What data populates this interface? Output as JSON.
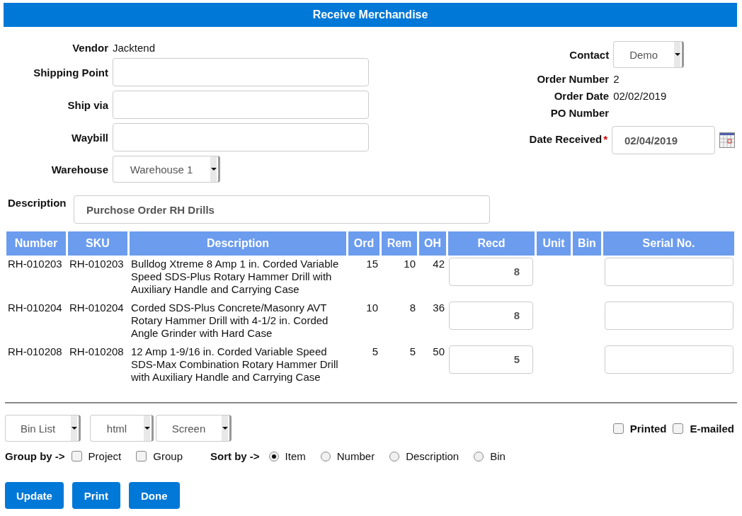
{
  "window": {
    "title": "Receive Merchandise"
  },
  "left_fields": [
    {
      "kind": "text",
      "label": "Vendor",
      "value": "Jacktend"
    },
    {
      "kind": "input",
      "label": "Shipping Point"
    },
    {
      "kind": "input",
      "label": "Ship via"
    },
    {
      "kind": "input",
      "label": "Waybill"
    },
    {
      "kind": "select",
      "label": "Warehouse",
      "value": "Warehouse 1"
    }
  ],
  "right_fields": [
    {
      "kind": "select",
      "label": "Contact",
      "value": "Demo"
    },
    {
      "kind": "text",
      "label": "Order Number",
      "value": "2"
    },
    {
      "kind": "text",
      "label": "Order Date",
      "value": "02/02/2019"
    },
    {
      "kind": "text",
      "label": "PO Number"
    },
    {
      "kind": "date",
      "label": "Date Received",
      "required_mark": "*",
      "value": "02/04/2019"
    }
  ],
  "description": {
    "label": "Description",
    "value": "Purchose Order RH Drills"
  },
  "table": {
    "columns": [
      "Number",
      "SKU",
      "Description",
      "Ord",
      "Rem",
      "OH",
      "Recd",
      "Unit",
      "Bin",
      "Serial No."
    ],
    "rows": [
      {
        "number": "RH-010203",
        "sku": "RH-010203",
        "description": "Bulldog Xtreme 8 Amp 1 in. Corded Variable Speed SDS-Plus Rotary Hammer Drill with Auxiliary Handle and Carrying Case",
        "ord": "15",
        "rem": "10",
        "oh": "42",
        "recd": "8"
      },
      {
        "number": "RH-010204",
        "sku": "RH-010204",
        "description": "Corded SDS-Plus Concrete/Masonry AVT Rotary Hammer Drill with 4-1/2 in. Corded Angle Grinder with Hard Case",
        "ord": "10",
        "rem": "8",
        "oh": "36",
        "recd": "8"
      },
      {
        "number": "RH-010208",
        "sku": "RH-010208",
        "description": "12 Amp 1-9/16 in. Corded Variable Speed SDS-Max Combination Rotary Hammer Drill with Auxiliary Handle and Carrying Case",
        "ord": "5",
        "rem": "5",
        "oh": "50",
        "recd": "5"
      }
    ]
  },
  "output_selects": [
    {
      "value": "Bin List"
    },
    {
      "value": "html"
    },
    {
      "value": "Screen"
    }
  ],
  "flags": [
    {
      "label": "Printed",
      "checked": false
    },
    {
      "label": "E-mailed",
      "checked": false
    }
  ],
  "group_by": {
    "label": "Group by ->",
    "options": [
      {
        "label": "Project",
        "checked": false
      },
      {
        "label": "Group",
        "checked": false
      }
    ]
  },
  "sort_by": {
    "label": "Sort by ->",
    "options": [
      {
        "label": "Item",
        "selected": true
      },
      {
        "label": "Number",
        "selected": false
      },
      {
        "label": "Description",
        "selected": false
      },
      {
        "label": "Bin",
        "selected": false
      }
    ]
  },
  "buttons": [
    "Update",
    "Print",
    "Done"
  ]
}
